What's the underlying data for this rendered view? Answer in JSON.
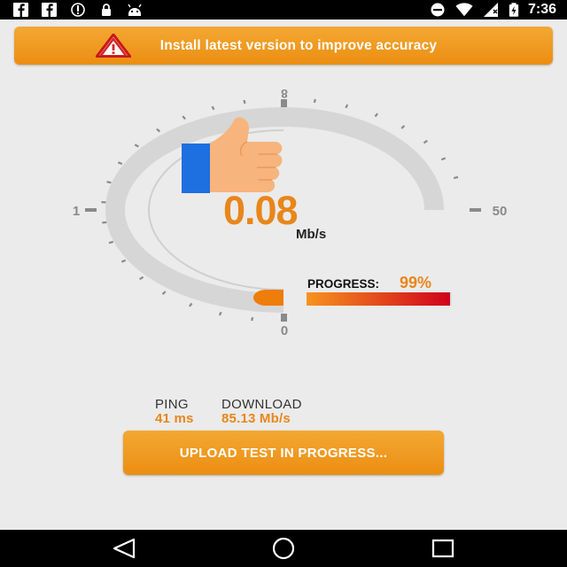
{
  "status_bar": {
    "left_icons": [
      "facebook-icon",
      "facebook-icon",
      "vpn-icon",
      "lock-icon",
      "android-icon"
    ],
    "right_icons": [
      "do-not-disturb-icon",
      "wifi-icon",
      "signal-icon",
      "battery-charging-icon"
    ],
    "time": "7:36"
  },
  "banner": {
    "icon": "warning-icon",
    "text": "Install latest version to improve accuracy"
  },
  "gauge": {
    "scale_min": "0",
    "scale_low": "1",
    "scale_max": "50",
    "scale_top": "8",
    "speed_value": "0.08",
    "speed_unit": "Mb/s",
    "fill_fraction": 0.05,
    "thumb_icon": "thumbs-up-icon"
  },
  "progress": {
    "label": "PROGRESS:",
    "value": "99%",
    "fraction": 0.99
  },
  "stats": {
    "ping_label": "PING",
    "ping_value": "41 ms",
    "download_label": "DOWNLOAD",
    "download_value": "85.13 Mb/s"
  },
  "upload_button": {
    "label": "UPLOAD TEST IN PROGRESS..."
  },
  "nav_bar": {
    "icons": [
      "back-icon",
      "home-icon",
      "recents-icon"
    ]
  },
  "colors": {
    "accent": "#e8861a",
    "button": "#ef9a22",
    "progress_end": "#d0021b"
  }
}
